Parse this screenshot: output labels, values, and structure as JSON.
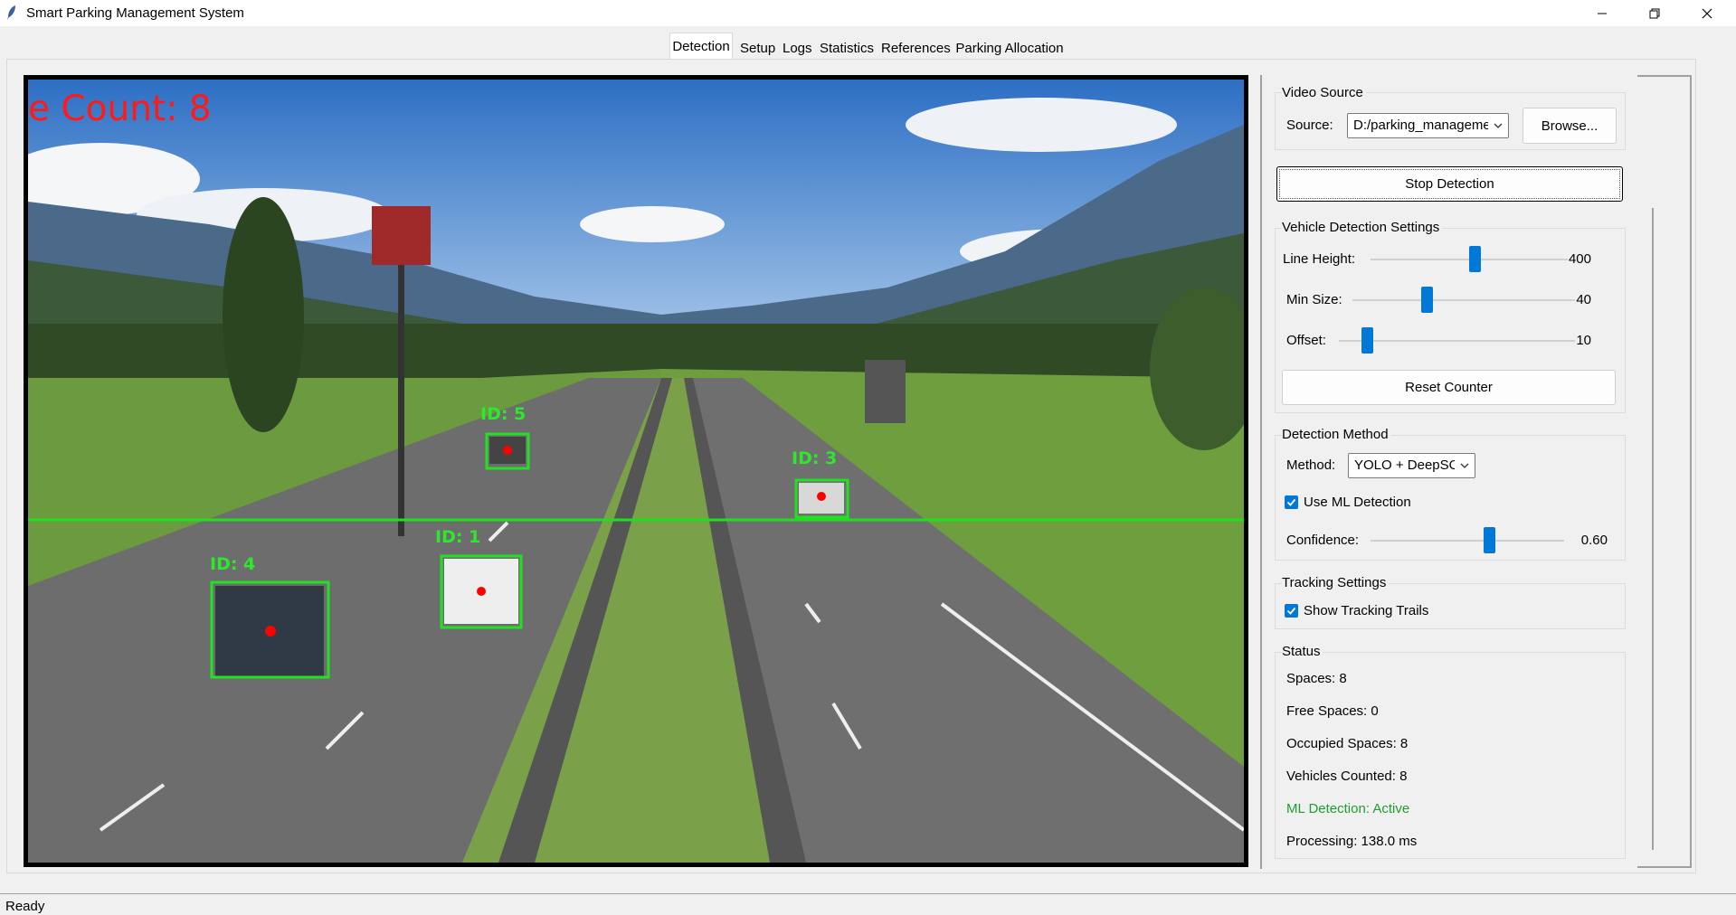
{
  "window": {
    "title": "Smart Parking Management System",
    "controls": [
      "minimize-icon",
      "restore-icon",
      "close-icon"
    ]
  },
  "tabs": [
    {
      "label": "Detection",
      "active": true
    },
    {
      "label": "Setup"
    },
    {
      "label": "Logs"
    },
    {
      "label": "Statistics"
    },
    {
      "label": "References"
    },
    {
      "label": "Parking Allocation"
    }
  ],
  "video": {
    "overlay_count": "e Count: 8",
    "detections": [
      {
        "id_label": "ID: 5"
      },
      {
        "id_label": "ID: 3"
      },
      {
        "id_label": "ID: 1"
      },
      {
        "id_label": "ID: 4"
      }
    ],
    "box_color": "#22e022",
    "centroid_color": "#ff0000",
    "count_line_color": "#1ee01e"
  },
  "video_source": {
    "title": "Video Source",
    "source_label": "Source:",
    "source_value": "D:/parking_management",
    "browse_label": "Browse..."
  },
  "stop_detection_label": "Stop Detection",
  "vehicle_settings": {
    "title": "Vehicle Detection Settings",
    "line_height": {
      "label": "Line Height:",
      "value": "400",
      "fraction": 0.53
    },
    "min_size": {
      "label": "Min Size:",
      "value": "40",
      "fraction": 0.33
    },
    "offset": {
      "label": "Offset:",
      "value": "10",
      "fraction": 0.12
    },
    "reset_label": "Reset Counter"
  },
  "detection_method": {
    "title": "Detection Method",
    "method_label": "Method:",
    "method_value": "YOLO + DeepSORT",
    "use_ml_label": "Use ML Detection",
    "use_ml_checked": true,
    "confidence_label": "Confidence:",
    "confidence_value": "0.60",
    "confidence_fraction": 0.6
  },
  "tracking": {
    "title": "Tracking Settings",
    "trails_label": "Show Tracking Trails",
    "trails_checked": true
  },
  "status": {
    "title": "Status",
    "spaces": "Spaces: 8",
    "free_spaces": "Free Spaces: 0",
    "occupied_spaces": "Occupied Spaces: 8",
    "vehicles_counted": "Vehicles Counted: 8",
    "ml_detection": "ML Detection: Active",
    "processing": "Processing: 138.0 ms"
  },
  "statusbar": {
    "text": "Ready"
  },
  "colors": {
    "accent": "#0078d7",
    "ml_active": "#1e9e2e"
  }
}
